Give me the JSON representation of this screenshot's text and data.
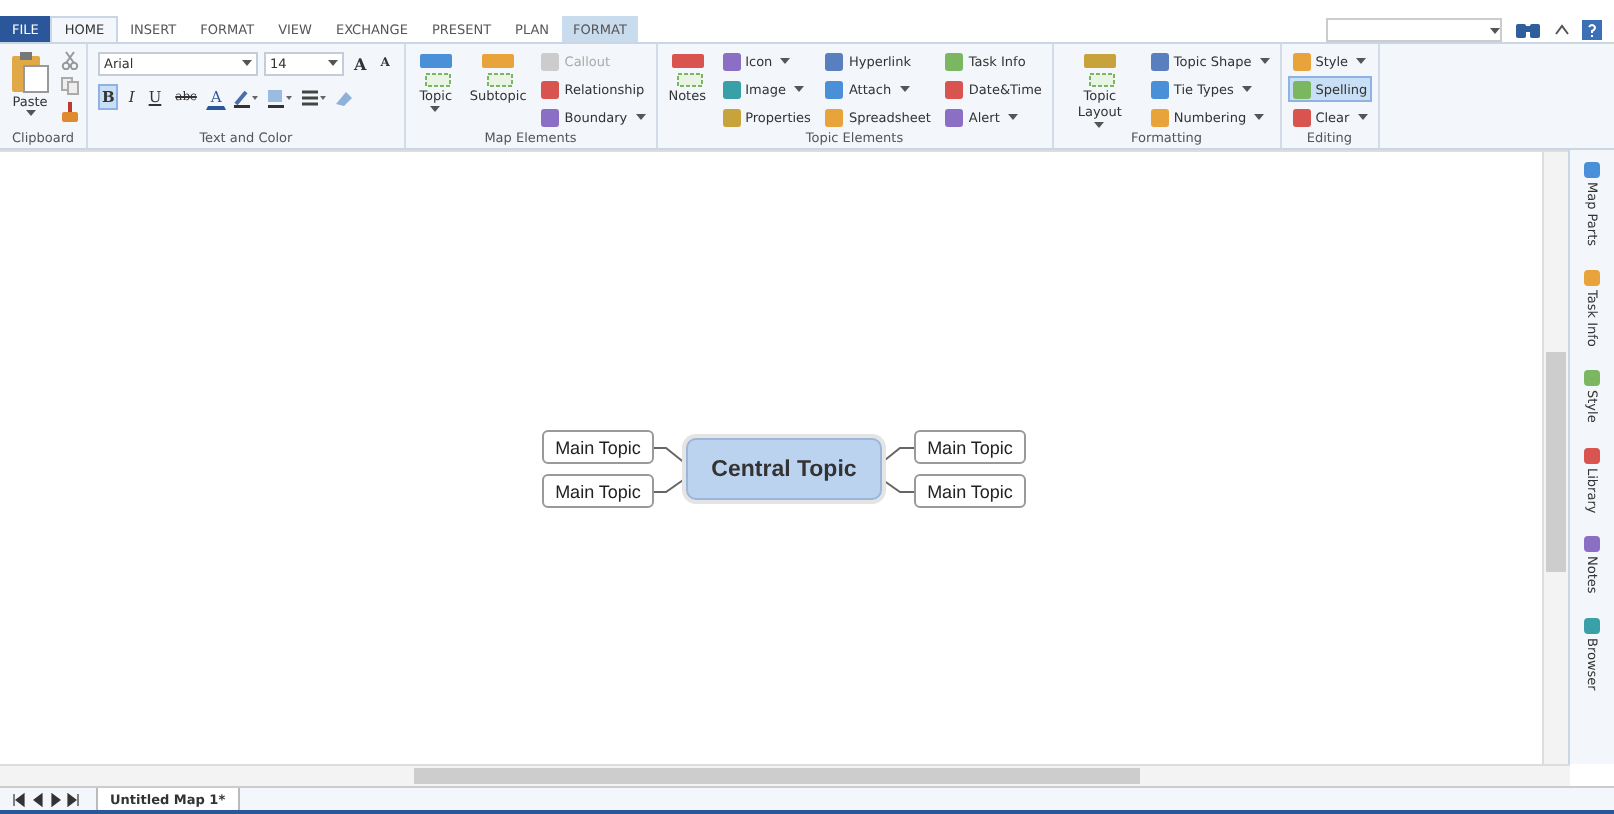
{
  "tabs": [
    {
      "label": "FILE",
      "kind": "file",
      "selected": false
    },
    {
      "label": "HOME",
      "kind": "normal",
      "selected": true
    },
    {
      "label": "INSERT",
      "kind": "normal",
      "selected": false
    },
    {
      "label": "FORMAT",
      "kind": "normal",
      "selected": false
    },
    {
      "label": "VIEW",
      "kind": "normal",
      "selected": false
    },
    {
      "label": "EXCHANGE",
      "kind": "normal",
      "selected": false
    },
    {
      "label": "PRESENT",
      "kind": "normal",
      "selected": false
    },
    {
      "label": "PLAN",
      "kind": "normal",
      "selected": false
    },
    {
      "label": "FORMAT",
      "kind": "context",
      "selected": false
    }
  ],
  "ribbon": {
    "clipboard": {
      "label": "Clipboard",
      "paste": "Paste"
    },
    "text_and_color": {
      "label": "Text and Color",
      "font": "Arial",
      "size": "14",
      "grow": "A",
      "shrink": "A",
      "format_buttons": [
        {
          "label": "B",
          "selected": true
        },
        {
          "label": "I",
          "selected": false
        },
        {
          "label": "U",
          "selected": false
        },
        {
          "label": "abc",
          "selected": false
        }
      ],
      "font_color": "A"
    },
    "groups": [
      {
        "label": "Map Elements",
        "items": [
          {
            "label": "Topic",
            "kind": "large",
            "dropdown": true,
            "disabled": false,
            "selected": false
          },
          {
            "label": "Subtopic",
            "kind": "large",
            "dropdown": false,
            "disabled": false,
            "selected": false
          },
          {
            "label": "Callout",
            "kind": "small",
            "dropdown": false,
            "disabled": true,
            "selected": false
          },
          {
            "label": "Relationship",
            "kind": "small",
            "dropdown": false,
            "disabled": false,
            "selected": false
          },
          {
            "label": "Boundary",
            "kind": "small",
            "dropdown": true,
            "disabled": false,
            "selected": false
          }
        ]
      },
      {
        "label": "Topic Elements",
        "items": [
          {
            "label": "Notes",
            "kind": "large",
            "dropdown": false,
            "disabled": false,
            "selected": false
          },
          {
            "label": "Icon",
            "kind": "small",
            "dropdown": true,
            "disabled": false,
            "selected": false
          },
          {
            "label": "Image",
            "kind": "small",
            "dropdown": true,
            "disabled": false,
            "selected": false
          },
          {
            "label": "Properties",
            "kind": "small",
            "dropdown": false,
            "disabled": false,
            "selected": false
          },
          {
            "label": "Hyperlink",
            "kind": "small",
            "dropdown": false,
            "disabled": false,
            "selected": false
          },
          {
            "label": "Attach",
            "kind": "small",
            "dropdown": true,
            "disabled": false,
            "selected": false
          },
          {
            "label": "Spreadsheet",
            "kind": "small",
            "dropdown": false,
            "disabled": false,
            "selected": false
          },
          {
            "label": "Task Info",
            "kind": "small",
            "dropdown": false,
            "disabled": false,
            "selected": false
          },
          {
            "label": "Date&Time",
            "kind": "small",
            "dropdown": false,
            "disabled": false,
            "selected": false
          },
          {
            "label": "Alert",
            "kind": "small",
            "dropdown": true,
            "disabled": false,
            "selected": false
          }
        ]
      },
      {
        "label": "Formatting",
        "items": [
          {
            "label": "Topic Layout",
            "kind": "large",
            "dropdown": true,
            "disabled": false,
            "selected": false
          },
          {
            "label": "Topic Shape",
            "kind": "small",
            "dropdown": true,
            "disabled": false,
            "selected": false
          },
          {
            "label": "Tie Types",
            "kind": "small",
            "dropdown": true,
            "disabled": false,
            "selected": false
          },
          {
            "label": "Numbering",
            "kind": "small",
            "dropdown": true,
            "disabled": false,
            "selected": false
          }
        ]
      },
      {
        "label": "Editing",
        "items": [
          {
            "label": "Style",
            "kind": "small",
            "dropdown": true,
            "disabled": false,
            "selected": false
          },
          {
            "label": "Spelling",
            "kind": "small",
            "dropdown": false,
            "disabled": false,
            "selected": true
          },
          {
            "label": "Clear",
            "kind": "small",
            "dropdown": true,
            "disabled": false,
            "selected": false
          }
        ]
      }
    ]
  },
  "map": {
    "central": "Central Topic",
    "left_topics": [
      "Main Topic",
      "Main Topic"
    ],
    "right_topics": [
      "Main Topic",
      "Main Topic"
    ]
  },
  "side_panel": [
    "Map Parts",
    "Task Info",
    "Style",
    "Library",
    "Notes",
    "Browser"
  ],
  "sheet_tabs": [
    {
      "label": "Untitled Map 1*",
      "selected": true
    }
  ]
}
